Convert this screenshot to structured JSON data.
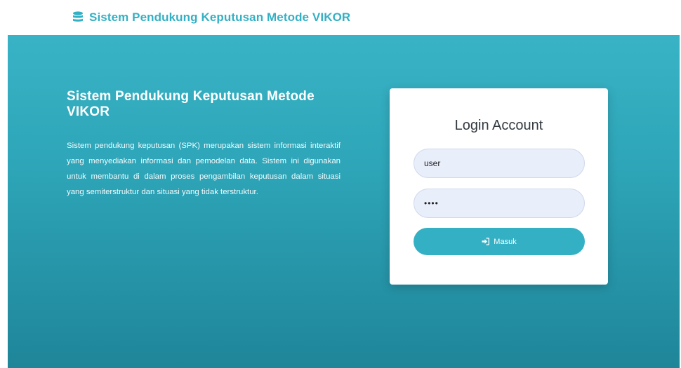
{
  "navbar": {
    "brand_icon": "database-icon",
    "brand_title": "Sistem Pendukung Keputusan Metode VIKOR"
  },
  "intro": {
    "title": "Sistem Pendukung Keputusan Metode VIKOR",
    "description": "Sistem pendukung keputusan (SPK) merupakan sistem informasi interaktif yang menyediakan informasi dan pemodelan data. Sistem ini digunakan untuk membantu di dalam proses pengambilan keputusan dalam situasi yang semiterstruktur dan situasi yang tidak terstruktur."
  },
  "login": {
    "title": "Login Account",
    "username_value": "user",
    "password_value": "••••",
    "submit_icon": "sign-in-icon",
    "submit_label": "Masuk"
  },
  "colors": {
    "accent": "#34b0c4",
    "hero_top": "#38b3c5",
    "hero_bottom": "#1f8599",
    "input_bg": "#e9eefb"
  }
}
